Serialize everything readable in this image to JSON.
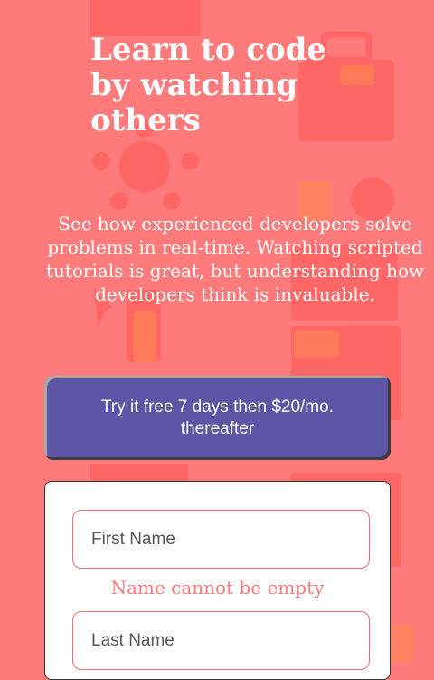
{
  "hero": {
    "headline": "Learn to code by watching others",
    "description": "See how experienced developers solve problems in real-time. Watching scripted tutorials is great, but understanding how developers think is invaluable."
  },
  "cta": {
    "label": "Try it free 7 days then $20/mo. thereafter"
  },
  "form": {
    "first_name": {
      "placeholder": "First Name",
      "value": ""
    },
    "first_name_error": "Name cannot be empty",
    "last_name": {
      "placeholder": "Last Name",
      "value": ""
    }
  },
  "colors": {
    "background": "#ff7b7b",
    "cta": "#5d55a5",
    "card": "#ffffff",
    "error": "#ff7b7b",
    "field_border": "#f26d6d"
  },
  "decor_icons": [
    "house-icon",
    "toolbox-icon",
    "network-icon",
    "folder-icon",
    "cursor-icon",
    "refresh-icon",
    "clipboard-icon",
    "bookmark-icon"
  ]
}
